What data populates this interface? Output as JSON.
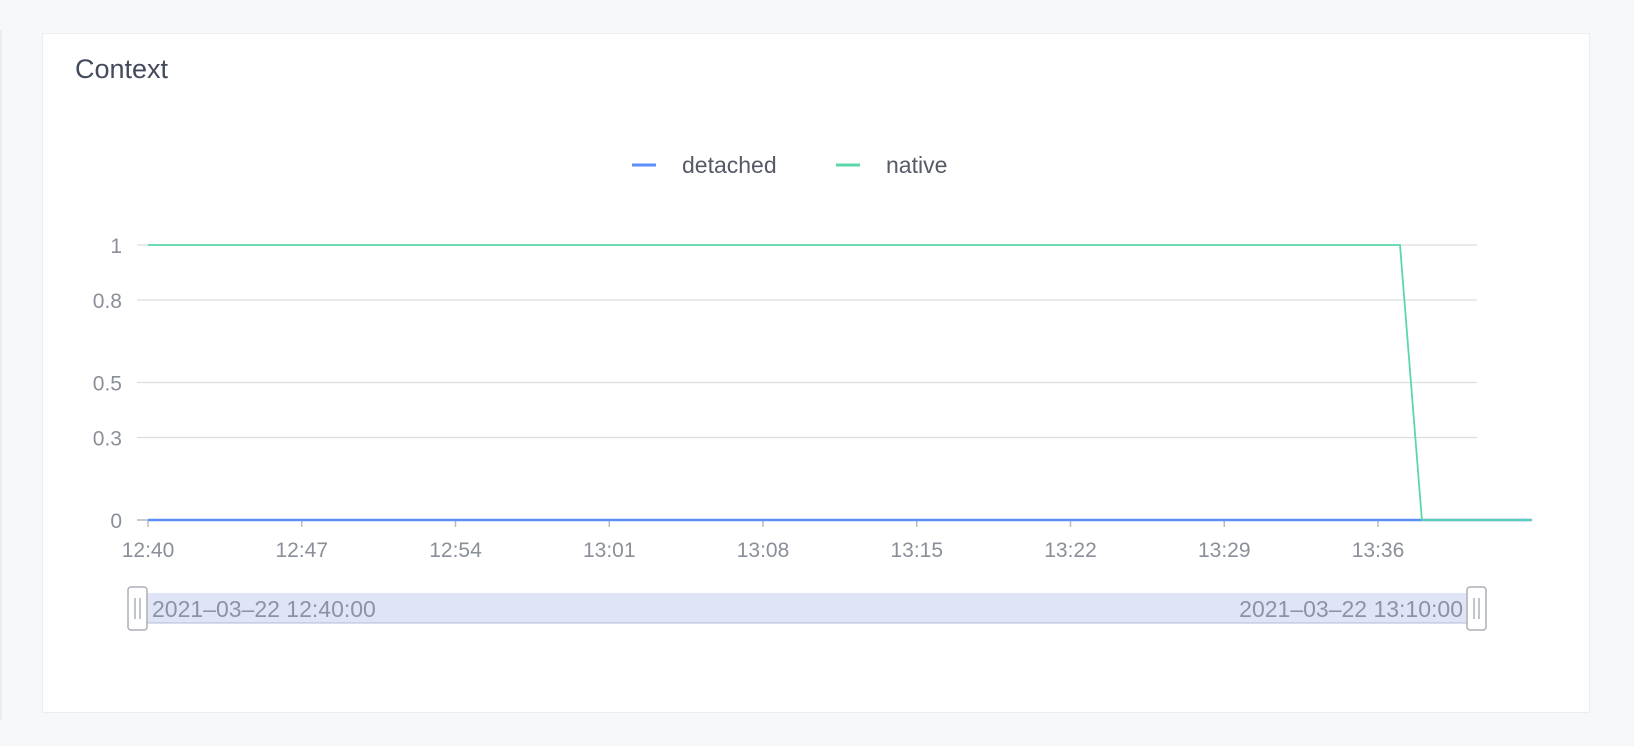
{
  "panel": {
    "title": "Context"
  },
  "chart_data": {
    "type": "line",
    "title": "",
    "xlabel": "",
    "ylabel": "",
    "x_ticks": [
      "12:40",
      "12:47",
      "12:54",
      "13:01",
      "13:08",
      "13:15",
      "13:22",
      "13:29",
      "13:36"
    ],
    "x_range": [
      "12:40",
      "13:43"
    ],
    "y_ticks": [
      0,
      0.3,
      0.5,
      0.8,
      1
    ],
    "y_tick_labels": [
      "0",
      "0.3",
      "0.5",
      "0.8",
      "1"
    ],
    "ylim": [
      0,
      1
    ],
    "grid": true,
    "legend": "top-center",
    "series": [
      {
        "name": "detached",
        "color": "#5b8ff9",
        "points": [
          [
            "12:40",
            0
          ],
          [
            "13:43",
            0
          ]
        ]
      },
      {
        "name": "native",
        "color": "#5ad8a6",
        "points": [
          [
            "12:40",
            1
          ],
          [
            "13:37",
            1
          ],
          [
            "13:38",
            0
          ],
          [
            "13:43",
            0
          ]
        ]
      }
    ]
  },
  "zoom_slider": {
    "start_label": "2021–03–22 12:40:00",
    "end_label": "2021–03–22 13:10:00",
    "range_fill": "#dfe5f7",
    "handle_icon": "grip-handle-icon"
  }
}
